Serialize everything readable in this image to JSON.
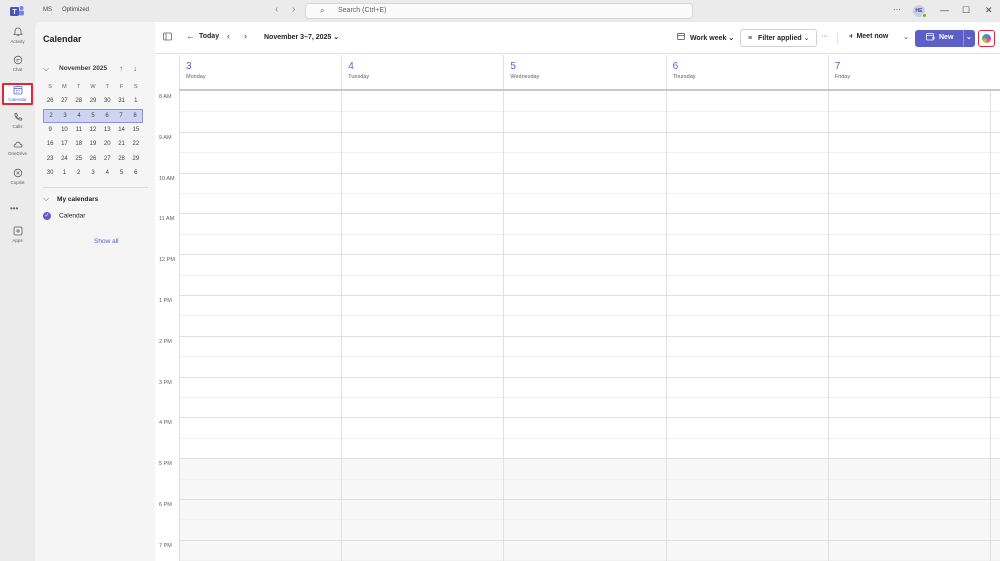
{
  "titlebar": {
    "org_initials": "MS",
    "org_name": "Optimized",
    "back_icon": "chevron-left-icon",
    "forward_icon": "chevron-right-icon",
    "search_placeholder": "Search (Ctrl+E)",
    "more_label": "···",
    "avatar_initials": "HE",
    "minimize": "—",
    "maximize": "☐",
    "close": "✕"
  },
  "rail": {
    "items": [
      {
        "label": "Activity",
        "icon": "bell-icon",
        "glyph": "🔔"
      },
      {
        "label": "Chat",
        "icon": "chat-icon",
        "glyph": "💬"
      },
      {
        "label": "Calendar",
        "icon": "calendar-icon",
        "glyph": "📅"
      },
      {
        "label": "Calls",
        "icon": "phone-icon",
        "glyph": "☏"
      },
      {
        "label": "OneDrive",
        "icon": "cloud-icon",
        "glyph": "☁"
      },
      {
        "label": "Copilot",
        "icon": "copilot-icon",
        "glyph": "✺"
      },
      {
        "label": "Apps",
        "icon": "add-app-icon",
        "glyph": "⊞"
      }
    ],
    "more": "•••"
  },
  "sidepanel": {
    "title": "Calendar",
    "month_label": "November 2025",
    "weekdays": [
      "S",
      "M",
      "T",
      "W",
      "T",
      "F",
      "S"
    ],
    "weeks": [
      [
        "26",
        "27",
        "28",
        "29",
        "30",
        "31",
        "1"
      ],
      [
        "2",
        "3",
        "4",
        "5",
        "6",
        "7",
        "8"
      ],
      [
        "9",
        "10",
        "11",
        "12",
        "13",
        "14",
        "15"
      ],
      [
        "16",
        "17",
        "18",
        "19",
        "20",
        "21",
        "22"
      ],
      [
        "23",
        "24",
        "25",
        "26",
        "27",
        "28",
        "29"
      ],
      [
        "30",
        "1",
        "2",
        "3",
        "4",
        "5",
        "6"
      ]
    ],
    "selected_week_index": 1,
    "my_calendars_label": "My calendars",
    "calendar_item": "Calendar",
    "show_all": "Show all"
  },
  "toolbar": {
    "today": "Today",
    "date_range": "November 3–7, 2025",
    "view": "Work week",
    "filter": "Filter applied",
    "more": "···",
    "meet_now": "Meet now",
    "new_label": "New"
  },
  "days": [
    {
      "num": "3",
      "name": "Monday"
    },
    {
      "num": "4",
      "name": "Tuesday"
    },
    {
      "num": "5",
      "name": "Wednesday"
    },
    {
      "num": "6",
      "name": "Thursday"
    },
    {
      "num": "7",
      "name": "Friday"
    }
  ],
  "hours": [
    "8 AM",
    "9 AM",
    "10 AM",
    "11 AM",
    "12 PM",
    "1 PM",
    "2 PM",
    "3 PM",
    "4 PM",
    "5 PM",
    "6 PM",
    "7 PM"
  ],
  "colors": {
    "accent": "#5b5fc7",
    "highlight_border": "#e0263a"
  }
}
